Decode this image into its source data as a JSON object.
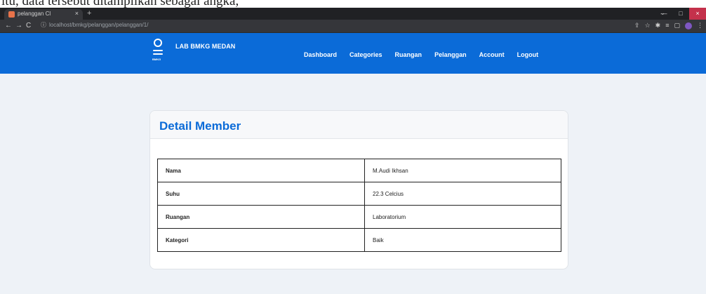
{
  "doc_text": "itu, data tersebut ditampilkan sebagai angka,",
  "browser": {
    "tab_title": "pelanggan Cl",
    "tab_close": "×",
    "new_tab": "+",
    "url": "localhost/bmkg/pelanggan/pelanggan/1/",
    "back": "←",
    "forward": "→",
    "reload": "C",
    "window_controls": {
      "minimize": "—",
      "maximize": "□",
      "close": "×"
    },
    "dropdown": "⌄"
  },
  "navbar": {
    "brand": "LAB BMKG MEDAN",
    "logo_caption": "BMKG",
    "menu": [
      "Dashboard",
      "Categories",
      "Ruangan",
      "Pelanggan",
      "Account",
      "Logout"
    ]
  },
  "card": {
    "title": "Detail Member",
    "rows": [
      {
        "label": "Nama",
        "value": "M.Audi Ikhsan"
      },
      {
        "label": "Suhu",
        "value": "22.3 Celcius"
      },
      {
        "label": "Ruangan",
        "value": "Laboratorium"
      },
      {
        "label": "Kategori",
        "value": "Baik"
      }
    ]
  },
  "colors": {
    "accent": "#0b6bd8",
    "page_bg": "#eef2f7",
    "tab_favicon": "#e8734a"
  }
}
